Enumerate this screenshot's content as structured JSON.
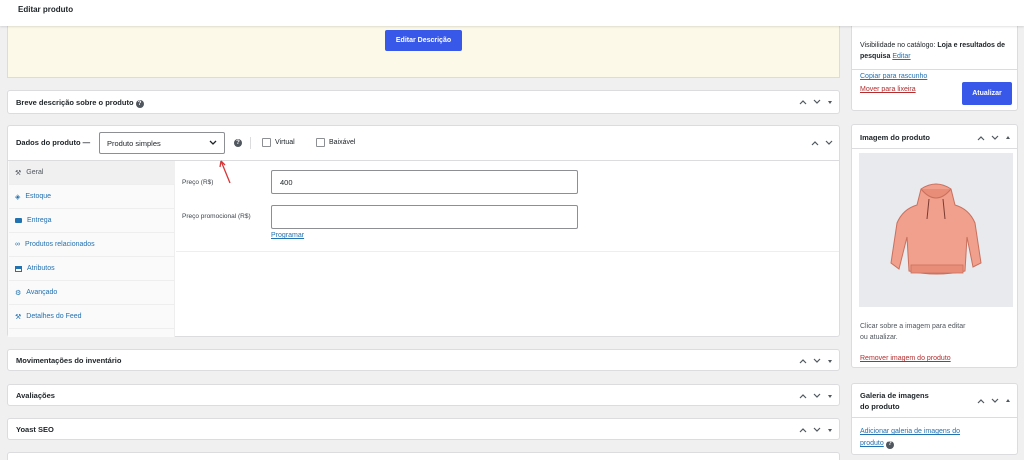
{
  "header": {
    "title": "Editar produto"
  },
  "description": {
    "edit_button": "Editar Descrição"
  },
  "short_description": {
    "title": "Breve descrição sobre o produto"
  },
  "product_data": {
    "title": "Dados do produto —",
    "type_selected": "Produto simples",
    "virtual_label": "Virtual",
    "downloadable_label": "Baixável",
    "tabs": [
      {
        "label": "Geral",
        "icon": "wrench-icon"
      },
      {
        "label": "Estoque",
        "icon": "diamond-icon"
      },
      {
        "label": "Entrega",
        "icon": "truck-icon"
      },
      {
        "label": "Produtos relacionados",
        "icon": "link-icon"
      },
      {
        "label": "Atributos",
        "icon": "table-icon"
      },
      {
        "label": "Avançado",
        "icon": "gear-icon"
      },
      {
        "label": "Detalhes do Feed",
        "icon": "wrench-icon"
      }
    ],
    "price_label": "Preço (R$)",
    "price_value": "400",
    "sale_label": "Preço promocional (R$)",
    "sale_value": "",
    "schedule_link": "Programar"
  },
  "inventory_moves": {
    "title": "Movimentações do inventário"
  },
  "reviews": {
    "title": "Avaliações"
  },
  "yoast": {
    "title": "Yoast SEO"
  },
  "publish": {
    "catalog_visibility_prefix": "Visibilidade no catálogo:",
    "catalog_visibility_value": "Loja e resultados de pesquisa",
    "catalog_edit_link": "Editar",
    "copy_draft": "Copiar para rascunho",
    "move_trash": "Mover para lixeira",
    "update_button": "Atualizar"
  },
  "product_image": {
    "title": "Imagem do produto",
    "hint_line1": "Clicar sobre a imagem para editar",
    "hint_line2": "ou atualizar.",
    "remove_link": "Remover imagem do produto"
  },
  "gallery": {
    "title_line1": "Galeria de imagens",
    "title_line2": "do produto",
    "add_link_line1": "Adicionar galeria de imagens do",
    "add_link_line2": "produto"
  },
  "colors": {
    "accent": "#3858e9",
    "link": "#2271b1",
    "danger": "#b32d2e",
    "desc_bg": "#fcf9e8"
  }
}
